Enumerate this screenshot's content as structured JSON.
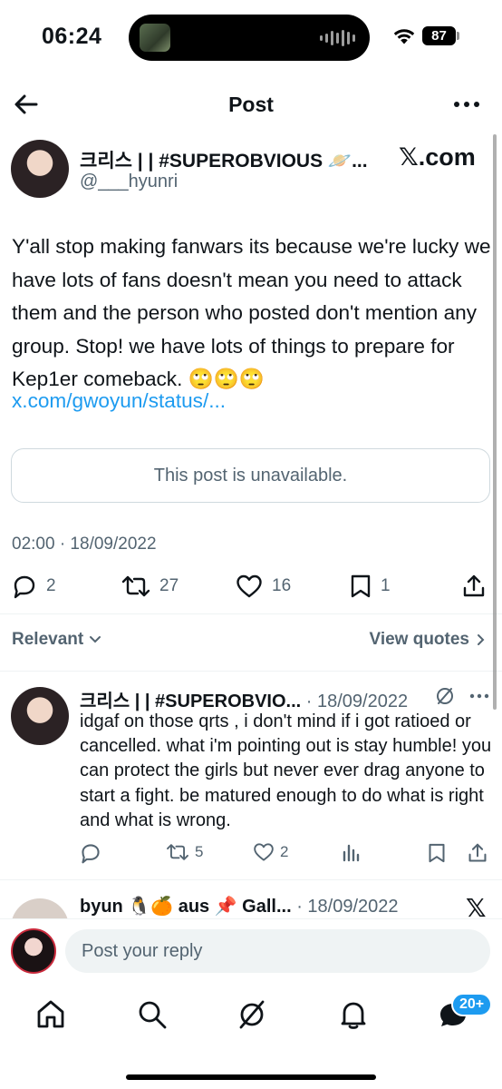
{
  "status_bar": {
    "time": "06:24",
    "battery": "87"
  },
  "nav": {
    "title": "Post"
  },
  "post": {
    "author_name": "크리스 | | #SUPEROBVIOUS 🪐...",
    "author_handle": "@___hyunri",
    "source_logo": "𝕏.com",
    "text": "Y'all stop making fanwars its because we're lucky we have lots of fans doesn't mean you need to attack them and the person who posted don't mention any group. Stop! we have lots of things to prepare for Kep1er comeback. 🙄🙄🙄",
    "link": "x.com/gwoyun/status/...",
    "quoted_unavailable": "This post is unavailable.",
    "timestamp": "02:00 · 18/09/2022",
    "stats": {
      "replies": "2",
      "reposts": "27",
      "likes": "16",
      "bookmarks": "1"
    }
  },
  "sort": {
    "label": "Relevant",
    "view_quotes": "View quotes"
  },
  "replies": [
    {
      "author": "크리스 | | #SUPEROBVIO...",
      "date": " · 18/09/2022",
      "text": "idgaf on those qrts , i don't mind if i got ratioed or cancelled. what i'm pointing out is stay humble! you can protect the girls but never ever drag anyone to start a fight. be matured enough to do what is right and what is wrong.",
      "reposts": "5",
      "likes": "2"
    },
    {
      "author": "byun 🐧🍊 aus 📌 Gall...",
      "date": " · 18/09/2022"
    }
  ],
  "composer": {
    "placeholder": "Post your reply"
  },
  "tabbar": {
    "badge": "20+"
  },
  "colors": {
    "accent": "#1d9bf0",
    "muted": "#536471",
    "text": "#0f1419",
    "border": "#cfd9de"
  }
}
